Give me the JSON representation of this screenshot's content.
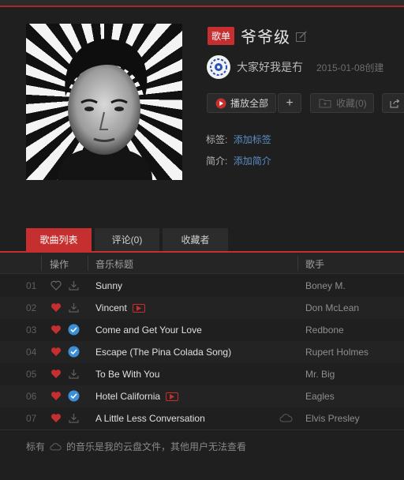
{
  "playlist": {
    "badge": "歌单",
    "title": "爷爷级",
    "creator": "大家好我是冇",
    "created": "2015-01-08创建"
  },
  "actions": {
    "play_all": "播放全部",
    "add": "+",
    "favorite": "收藏(0)"
  },
  "meta": {
    "tags_label": "标签:",
    "tags_link": "添加标签",
    "intro_label": "简介:",
    "intro_link": "添加简介"
  },
  "tabs": [
    "歌曲列表",
    "评论(0)",
    "收藏者"
  ],
  "columns": {
    "ops": "操作",
    "title": "音乐标题",
    "artist": "歌手"
  },
  "songs": [
    {
      "num": "01",
      "title": "Sunny",
      "artist": "Boney M.",
      "liked": false,
      "downloaded": false,
      "mv": false,
      "cloud": false
    },
    {
      "num": "02",
      "title": "Vincent",
      "artist": "Don McLean",
      "liked": true,
      "downloaded": false,
      "mv": true,
      "cloud": false
    },
    {
      "num": "03",
      "title": "Come and Get Your Love",
      "artist": "Redbone",
      "liked": true,
      "downloaded": true,
      "mv": false,
      "cloud": false
    },
    {
      "num": "04",
      "title": "Escape (The Pina Colada Song)",
      "artist": "Rupert Holmes",
      "liked": true,
      "downloaded": true,
      "mv": false,
      "cloud": false
    },
    {
      "num": "05",
      "title": "To Be With You",
      "artist": "Mr. Big",
      "liked": true,
      "downloaded": false,
      "mv": false,
      "cloud": false
    },
    {
      "num": "06",
      "title": "Hotel California",
      "artist": "Eagles",
      "liked": true,
      "downloaded": true,
      "mv": true,
      "cloud": false
    },
    {
      "num": "07",
      "title": "A Little Less Conversation",
      "artist": "Elvis Presley",
      "liked": true,
      "downloaded": false,
      "mv": false,
      "cloud": true
    }
  ],
  "footer": {
    "prefix": "标有",
    "suffix": "的音乐是我的云盘文件，其他用户无法查看"
  },
  "colors": {
    "accent": "#c62f2f",
    "link": "#5d8dc5",
    "check": "#3b8fd6"
  }
}
